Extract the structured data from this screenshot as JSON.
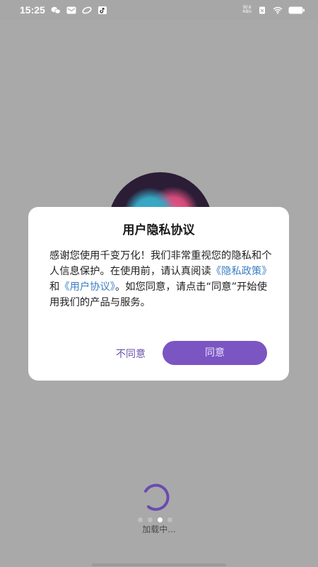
{
  "status_bar": {
    "time": "15:25",
    "net_speed_value": "50.6",
    "net_speed_unit": "KB/s",
    "icons": [
      "wechat-icon",
      "message-icon",
      "link-icon",
      "tiktok-icon",
      "sim-icon",
      "wifi-icon",
      "battery-icon"
    ]
  },
  "dialog": {
    "title": "用户隐私协议",
    "body_part1": "感谢您使用千变万化！我们非常重视您的隐私和个人信息保护。在使用前，请认真阅读",
    "privacy_policy_link": "《隐私政策》",
    "and_text": "和",
    "user_agreement_link": "《用户协议》",
    "body_part2": "。如您同意，请点击“同意”开始使用我们的产品与服务。",
    "decline_label": "不同意",
    "agree_label": "同意"
  },
  "loading": {
    "text": "加载中...",
    "dot_count": 4,
    "active_dot": 3
  },
  "colors": {
    "accent": "#7b55c2",
    "link": "#3d7fc4",
    "overlay": "#a9a9a9"
  }
}
